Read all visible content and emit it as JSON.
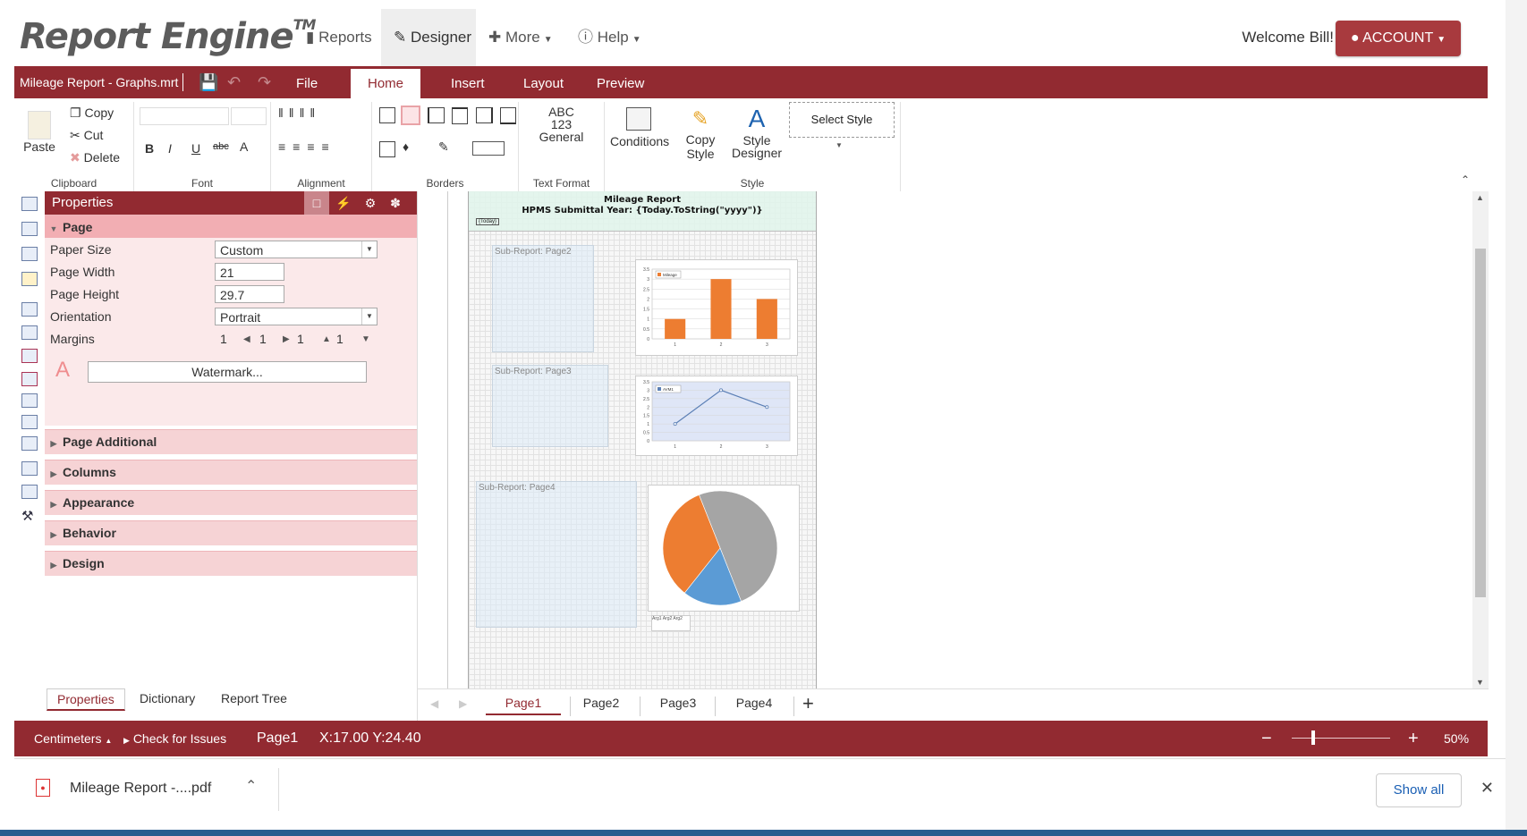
{
  "app": {
    "logo": "Report Engine",
    "logo_tm": "TM",
    "nav": [
      {
        "label": "Reports",
        "icon": "bar-chart-icon"
      },
      {
        "label": "Designer",
        "icon": "pencil-icon"
      },
      {
        "label": "More",
        "icon": "plus-icon"
      },
      {
        "label": "Help",
        "icon": "info-icon"
      }
    ],
    "welcome": "Welcome Bill!",
    "account_label": "ACCOUNT"
  },
  "tabbar": {
    "report_title": "Mileage Report - Graphs.mrt",
    "tabs": [
      "File",
      "Home",
      "Insert",
      "Layout",
      "Preview"
    ],
    "active_tab": "Home"
  },
  "ribbon": {
    "clipboard": {
      "paste": "Paste",
      "copy": "Copy",
      "cut": "Cut",
      "delete": "Delete",
      "label": "Clipboard"
    },
    "font": {
      "label": "Font",
      "bold": "B",
      "italic": "I",
      "underline": "U",
      "strike": "abc",
      "color": "A"
    },
    "alignment": {
      "label": "Alignment"
    },
    "borders": {
      "label": "Borders"
    },
    "text_format": {
      "sample": "ABC",
      "sample2": "123",
      "general": "General",
      "label": "Text Format"
    },
    "style": {
      "conditions": "Conditions",
      "copy_style": "Copy Style",
      "style_designer_1": "Style",
      "style_designer_2": "Designer",
      "select_style": "Select Style",
      "label": "Style"
    }
  },
  "properties": {
    "title": "Properties",
    "page_section": "Page",
    "fields": {
      "paper_size_label": "Paper Size",
      "paper_size": "Custom",
      "page_width_label": "Page Width",
      "page_width": "21",
      "page_height_label": "Page Height",
      "page_height": "29.7",
      "orientation_label": "Orientation",
      "orientation": "Portrait",
      "margins_label": "Margins",
      "margins": [
        "1",
        "1",
        "1",
        "1"
      ]
    },
    "watermark": "Watermark...",
    "watermark_glyph": "A",
    "sections": [
      "Page Additional",
      "Columns",
      "Appearance",
      "Behavior",
      "Design"
    ],
    "bottom_tabs": [
      "Properties",
      "Dictionary",
      "Report Tree"
    ]
  },
  "canvas": {
    "header_title": "Mileage Report",
    "header_subtitle": "HPMS Submittal Year: {Today.ToString(\"yyyy\")}",
    "header_small": "{Today}",
    "subreports": [
      "Sub-Report: Page2",
      "Sub-Report: Page3",
      "Sub-Report: Page4"
    ]
  },
  "chart_data": [
    {
      "type": "bar",
      "categories": [
        "1",
        "2",
        "3"
      ],
      "series": [
        {
          "name": "Mileage",
          "values": [
            1,
            3,
            2
          ],
          "color": "#ed7d31"
        }
      ],
      "ylim": [
        0,
        3.5
      ],
      "yticks": [
        "0",
        "0.5",
        "1",
        "1.5",
        "2",
        "2.5",
        "3",
        "3.5"
      ]
    },
    {
      "type": "line",
      "categories": [
        "1",
        "2",
        "3"
      ],
      "series": [
        {
          "name": "AVM1",
          "values": [
            1,
            3,
            2
          ],
          "color": "#5b7fb5"
        }
      ],
      "ylim": [
        0,
        3.5
      ],
      "yticks": [
        "0",
        "0.5",
        "1",
        "1.5",
        "2",
        "2.5",
        "3",
        "3.5"
      ]
    },
    {
      "type": "pie",
      "series": [
        {
          "name": "",
          "values": [
            3,
            1,
            2
          ]
        }
      ],
      "slice_colors": [
        "#a5a5a5",
        "#5b9bd5",
        "#ed7d31"
      ],
      "legend": [
        "Arg1",
        "Arg2",
        "Arg2"
      ]
    }
  ],
  "page_tabs": [
    "Page1",
    "Page2",
    "Page3",
    "Page4"
  ],
  "status": {
    "units": "Centimeters",
    "check": "Check for Issues",
    "page": "Page1",
    "coords": "X:17.00 Y:24.40",
    "zoom": "50%"
  },
  "downloads": {
    "file": "Mileage Report -....pdf",
    "show_all": "Show all"
  },
  "colors": {
    "brand": "#922a31",
    "account": "#a83a3e",
    "section": "#f6d3d5"
  }
}
